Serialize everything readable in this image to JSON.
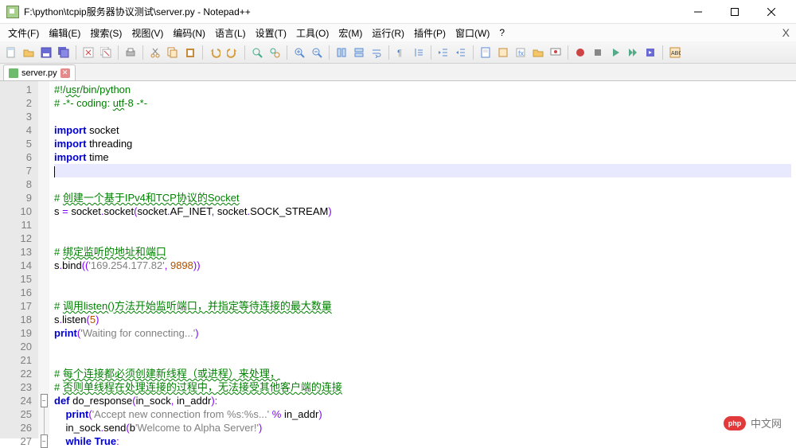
{
  "window": {
    "title": "F:\\python\\tcpip服务器协议测试\\server.py - Notepad++"
  },
  "menu": {
    "items": [
      "文件(F)",
      "编辑(E)",
      "搜索(S)",
      "视图(V)",
      "编码(N)",
      "语言(L)",
      "设置(T)",
      "工具(O)",
      "宏(M)",
      "运行(R)",
      "插件(P)",
      "窗口(W)",
      "?"
    ]
  },
  "tabs": {
    "active": {
      "label": "server.py"
    }
  },
  "code": {
    "lines": [
      {
        "n": 1,
        "seg": [
          [
            "com",
            "#!/"
          ],
          [
            "com u",
            "usr"
          ],
          [
            "com",
            "/bin/python"
          ]
        ]
      },
      {
        "n": 2,
        "seg": [
          [
            "com",
            "# -*- coding: "
          ],
          [
            "com u",
            "utf"
          ],
          [
            "com",
            "-8 -*-"
          ]
        ]
      },
      {
        "n": 3,
        "seg": []
      },
      {
        "n": 4,
        "seg": [
          [
            "kw",
            "import"
          ],
          [
            "",
            " socket"
          ]
        ]
      },
      {
        "n": 5,
        "seg": [
          [
            "kw",
            "import"
          ],
          [
            "",
            " threading"
          ]
        ]
      },
      {
        "n": 6,
        "seg": [
          [
            "kw",
            "import"
          ],
          [
            "",
            " time"
          ]
        ]
      },
      {
        "n": 7,
        "seg": [],
        "current": true
      },
      {
        "n": 8,
        "seg": []
      },
      {
        "n": 9,
        "seg": [
          [
            "com",
            "# "
          ],
          [
            "com u",
            "创建一个基于IPv4和TCP协议的Socket"
          ]
        ]
      },
      {
        "n": 10,
        "seg": [
          [
            "",
            "s "
          ],
          [
            "op",
            "="
          ],
          [
            "",
            " socket"
          ],
          [
            "op",
            "."
          ],
          [
            "",
            "socket"
          ],
          [
            "op",
            "("
          ],
          [
            "",
            "socket"
          ],
          [
            "op",
            "."
          ],
          [
            "",
            "AF_INET"
          ],
          [
            "op",
            ","
          ],
          [
            "",
            " socket"
          ],
          [
            "op",
            "."
          ],
          [
            "",
            "SOCK_STREAM"
          ],
          [
            "op",
            ")"
          ]
        ]
      },
      {
        "n": 11,
        "seg": []
      },
      {
        "n": 12,
        "seg": []
      },
      {
        "n": 13,
        "seg": [
          [
            "com",
            "# "
          ],
          [
            "com u",
            "绑定监听的地址和端口"
          ]
        ]
      },
      {
        "n": 14,
        "seg": [
          [
            "",
            "s"
          ],
          [
            "op",
            "."
          ],
          [
            "",
            "bind"
          ],
          [
            "op",
            "(("
          ],
          [
            "str",
            "'169.254.177.82'"
          ],
          [
            "op",
            ","
          ],
          [
            "",
            " "
          ],
          [
            "num",
            "9898"
          ],
          [
            "op",
            "))"
          ]
        ]
      },
      {
        "n": 15,
        "seg": []
      },
      {
        "n": 16,
        "seg": []
      },
      {
        "n": 17,
        "seg": [
          [
            "com",
            "# "
          ],
          [
            "com u",
            "调用listen()方法开始监听端口，并指定等待连接的最大数量"
          ]
        ]
      },
      {
        "n": 18,
        "seg": [
          [
            "",
            "s"
          ],
          [
            "op",
            "."
          ],
          [
            "",
            "listen"
          ],
          [
            "op",
            "("
          ],
          [
            "num",
            "5"
          ],
          [
            "op",
            ")"
          ]
        ]
      },
      {
        "n": 19,
        "seg": [
          [
            "kw",
            "print"
          ],
          [
            "op",
            "("
          ],
          [
            "str",
            "'Waiting for connecting...'"
          ],
          [
            "op",
            ")"
          ]
        ]
      },
      {
        "n": 20,
        "seg": []
      },
      {
        "n": 21,
        "seg": []
      },
      {
        "n": 22,
        "seg": [
          [
            "com",
            "# "
          ],
          [
            "com u",
            "每个连接都必须创建新线程（或进程）来处理，"
          ]
        ]
      },
      {
        "n": 23,
        "seg": [
          [
            "com",
            "# "
          ],
          [
            "com u",
            "否则单线程在处理连接的过程中，无法接受其他客户端的连接"
          ]
        ]
      },
      {
        "n": 24,
        "fold": "-",
        "seg": [
          [
            "kw",
            "def"
          ],
          [
            "",
            " do_response"
          ],
          [
            "op",
            "("
          ],
          [
            "",
            "in_sock"
          ],
          [
            "op",
            ","
          ],
          [
            "",
            " in_addr"
          ],
          [
            "op",
            ")"
          ],
          [
            "op",
            ":"
          ]
        ]
      },
      {
        "n": 25,
        "foldline": true,
        "seg": [
          [
            "",
            "    "
          ],
          [
            "kw",
            "print"
          ],
          [
            "op",
            "("
          ],
          [
            "str",
            "'Accept new connection from %s:%s...'"
          ],
          [
            "",
            " "
          ],
          [
            "op",
            "%"
          ],
          [
            "",
            " in_addr"
          ],
          [
            "op",
            ")"
          ]
        ]
      },
      {
        "n": 26,
        "foldline": true,
        "seg": [
          [
            "",
            "    in_sock"
          ],
          [
            "op",
            "."
          ],
          [
            "",
            "send"
          ],
          [
            "op",
            "("
          ],
          [
            "",
            "b"
          ],
          [
            "str",
            "'Welcome to Alpha Server!'"
          ],
          [
            "op",
            ")"
          ]
        ]
      },
      {
        "n": 27,
        "fold": "-",
        "foldline": true,
        "seg": [
          [
            "",
            "    "
          ],
          [
            "kw",
            "while"
          ],
          [
            "",
            " "
          ],
          [
            "kw",
            "True"
          ],
          [
            "op",
            ":"
          ]
        ]
      }
    ]
  },
  "watermark": {
    "logo": "php",
    "text": "中文网"
  }
}
